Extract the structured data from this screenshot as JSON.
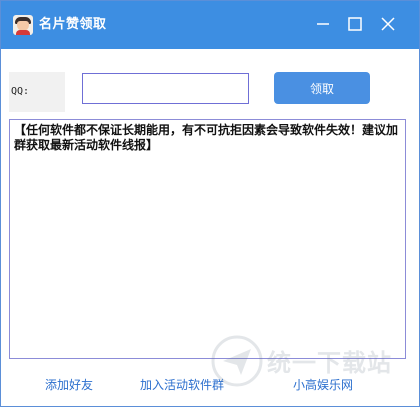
{
  "window": {
    "title": "名片赞领取",
    "titlebar_color": "#3d8ee2",
    "icon": "avatar-app-icon",
    "controls": [
      "minimize-icon",
      "maximize-icon",
      "close-icon"
    ]
  },
  "form": {
    "qq_label": "QQ:",
    "qq_value": "",
    "qq_placeholder": "",
    "submit_label": "领取",
    "button_color": "#4a90e2"
  },
  "notice": {
    "text": "【任何软件都不保证长期能用，有不可抗拒因素会导致软件失效！建议加群获取最新活动软件线报】"
  },
  "footer": {
    "links": [
      "添加好友",
      "加入活动软件群",
      "小高娱乐网"
    ],
    "link_color": "#2c6fce"
  },
  "watermark": {
    "text": "统一下载站"
  }
}
